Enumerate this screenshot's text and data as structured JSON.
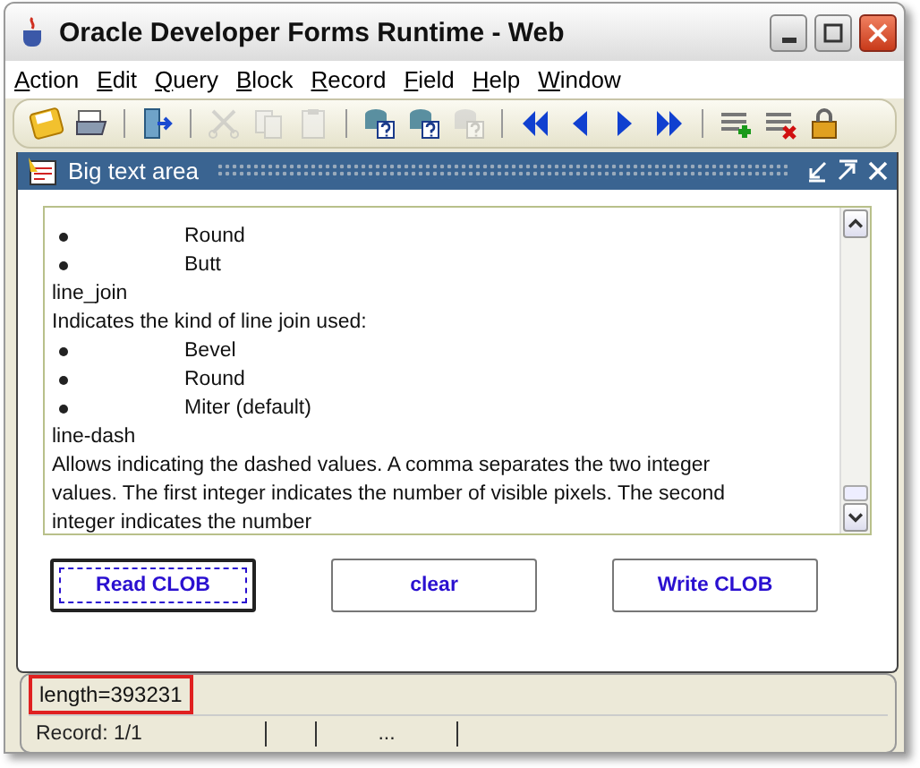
{
  "window": {
    "title": "Oracle Developer Forms Runtime - Web"
  },
  "menu": [
    {
      "label": "Action"
    },
    {
      "label": "Edit"
    },
    {
      "label": "Query"
    },
    {
      "label": "Block"
    },
    {
      "label": "Record"
    },
    {
      "label": "Field"
    },
    {
      "label": "Help"
    },
    {
      "label": "Window"
    }
  ],
  "toolbar": [
    {
      "kind": "save",
      "disabled": false
    },
    {
      "kind": "print",
      "disabled": false
    },
    {
      "kind": "sep"
    },
    {
      "kind": "exit",
      "disabled": false
    },
    {
      "kind": "sep"
    },
    {
      "kind": "cut",
      "disabled": true
    },
    {
      "kind": "copy",
      "disabled": true
    },
    {
      "kind": "paste",
      "disabled": true
    },
    {
      "kind": "sep"
    },
    {
      "kind": "query",
      "disabled": false
    },
    {
      "kind": "execute",
      "disabled": false
    },
    {
      "kind": "cancel",
      "disabled": true
    },
    {
      "kind": "sep"
    },
    {
      "kind": "first",
      "disabled": false
    },
    {
      "kind": "prev",
      "disabled": false
    },
    {
      "kind": "next",
      "disabled": false
    },
    {
      "kind": "last",
      "disabled": false
    },
    {
      "kind": "sep"
    },
    {
      "kind": "insert",
      "disabled": false
    },
    {
      "kind": "delete",
      "disabled": false
    },
    {
      "kind": "lock",
      "disabled": false
    }
  ],
  "frame": {
    "title": "Big text area"
  },
  "text_lines": [
    {
      "kind": "bullet",
      "text": "Round"
    },
    {
      "kind": "bullet",
      "text": "Butt"
    },
    {
      "kind": "plain",
      "text": "line_join"
    },
    {
      "kind": "plain",
      "text": "Indicates the kind of line join used:"
    },
    {
      "kind": "bullet",
      "text": "Bevel"
    },
    {
      "kind": "bullet",
      "text": "Round"
    },
    {
      "kind": "bullet",
      "text": "Miter (default)"
    },
    {
      "kind": "plain",
      "text": "line-dash"
    },
    {
      "kind": "plain",
      "text": "Allows indicating the dashed values. A comma separates the two integer"
    },
    {
      "kind": "plain",
      "text": "values.   The first integer indicates the number of visible pixels.  The second"
    },
    {
      "kind": "plain",
      "text": "integer indicates the number"
    }
  ],
  "buttons": [
    {
      "label": "Read CLOB",
      "focused": true
    },
    {
      "label": "clear",
      "focused": false
    },
    {
      "label": "Write CLOB",
      "focused": false
    }
  ],
  "status": {
    "message": "length=393231",
    "highlighted": true,
    "record": "Record: 1/1",
    "cell_3": "..."
  }
}
